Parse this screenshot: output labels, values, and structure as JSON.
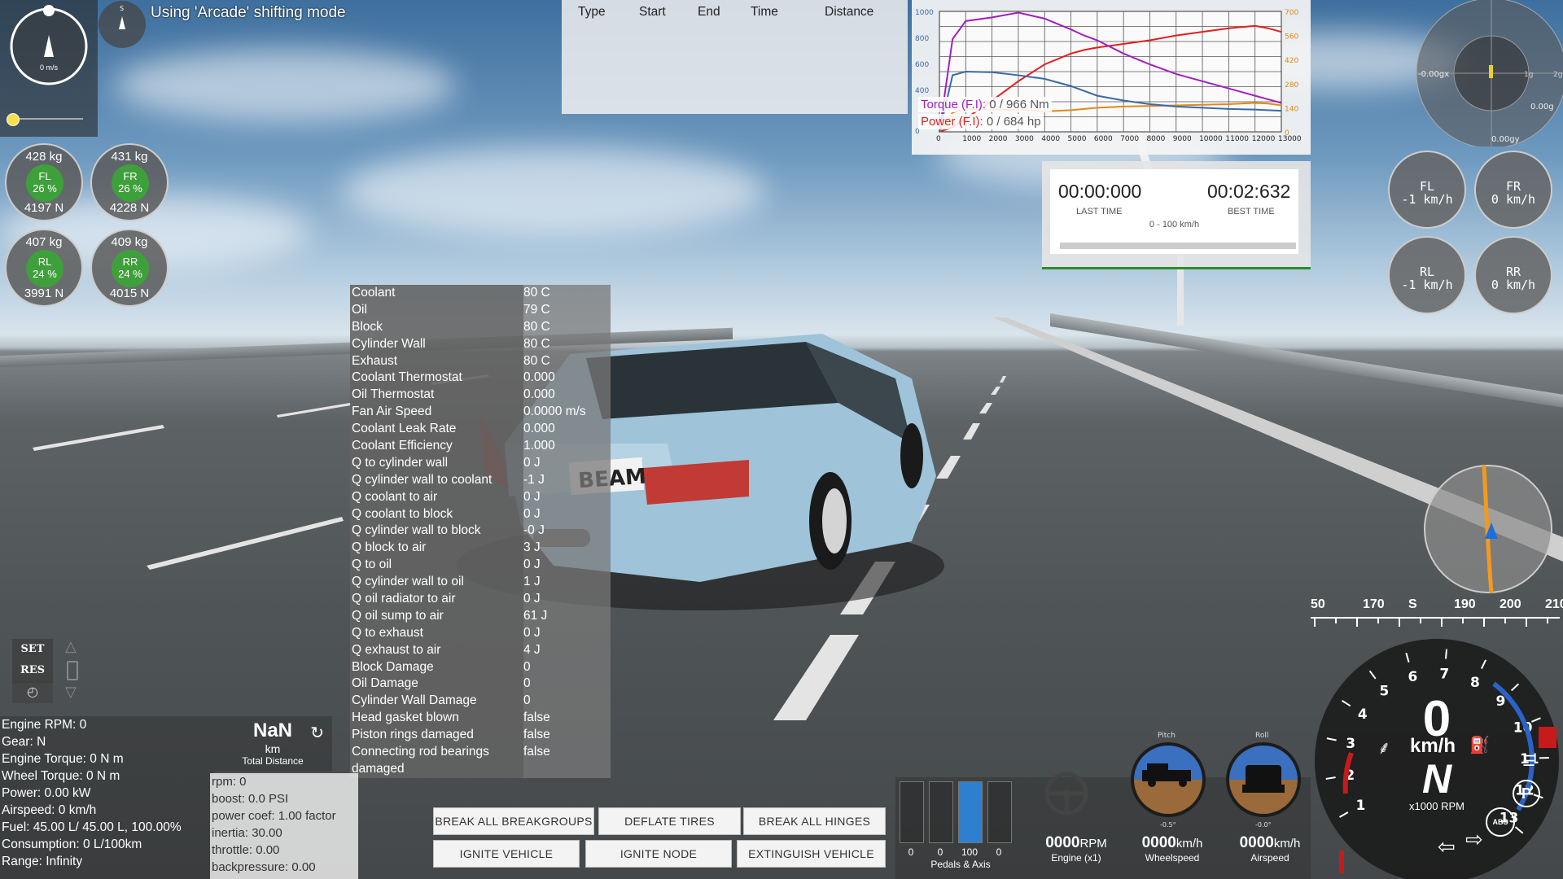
{
  "status_message": "Using 'Arcade' shifting mode",
  "compass_small": {
    "n_label": "S"
  },
  "compass_big": {
    "speed": "0 m/s"
  },
  "tires": [
    {
      "id": "FL",
      "mass": "428  kg",
      "pct": "26 %",
      "force": "4197  N"
    },
    {
      "id": "FR",
      "mass": "431  kg",
      "pct": "26 %",
      "force": "4228  N"
    },
    {
      "id": "RL",
      "mass": "407  kg",
      "pct": "24 %",
      "force": "3991  N"
    },
    {
      "id": "RR",
      "mass": "409  kg",
      "pct": "24 %",
      "force": "4015  N"
    }
  ],
  "drag_table": {
    "headers": [
      "Type",
      "Start",
      "End",
      "Time",
      "Distance"
    ]
  },
  "chart_data": {
    "type": "line",
    "left_ticks": [
      "1000",
      "800",
      "600",
      "400",
      "0"
    ],
    "right_ticks": [
      "700",
      "560",
      "420",
      "280",
      "140",
      "0"
    ],
    "x_ticks": [
      "0",
      "1000",
      "2000",
      "3000",
      "4000",
      "5000",
      "6000",
      "7000",
      "8000",
      "9000",
      "10000",
      "11000",
      "12000",
      "13000"
    ],
    "legend": [
      {
        "name": "Torque (F.I):",
        "value": "0 / 966 Nm",
        "color": "#a020c0"
      },
      {
        "name": "Power (F.I):",
        "value": "0 / 684 hp",
        "color": "#e02020"
      }
    ],
    "x": [
      0,
      500,
      1000,
      2000,
      3000,
      4000,
      5000,
      5500,
      6000,
      7000,
      8000,
      9000,
      10000,
      11000,
      12000,
      12500,
      13000
    ],
    "series": [
      {
        "color": "#e02020",
        "values": [
          0,
          40,
          110,
          260,
          420,
          560,
          650,
          680,
          700,
          730,
          760,
          800,
          830,
          860,
          880,
          860,
          830
        ]
      },
      {
        "color": "#a020c0",
        "values": [
          0,
          770,
          920,
          950,
          990,
          940,
          850,
          800,
          760,
          650,
          560,
          480,
          420,
          360,
          300,
          270,
          240
        ]
      },
      {
        "color": "#e08a1a",
        "values": [
          0,
          160,
          190,
          185,
          180,
          170,
          180,
          190,
          200,
          210,
          215,
          220,
          225,
          230,
          240,
          235,
          220
        ]
      },
      {
        "color": "#3a6aa6",
        "values": [
          0,
          470,
          500,
          495,
          470,
          440,
          380,
          340,
          300,
          260,
          230,
          210,
          200,
          190,
          185,
          180,
          175
        ]
      }
    ],
    "ylim": [
      0,
      1000
    ],
    "xlim": [
      0,
      13000
    ]
  },
  "timer": {
    "last_time": "00:00:000",
    "last_label": "LAST TIME",
    "best_time": "00:02:632",
    "best_label": "BEST TIME",
    "range": "0 - 100 km/h"
  },
  "wheel_speeds": [
    {
      "id": "FL",
      "speed": "-1 km/h"
    },
    {
      "id": "FR",
      "speed": "0 km/h"
    },
    {
      "id": "RL",
      "speed": "-1 km/h"
    },
    {
      "id": "RR",
      "speed": "0 km/h"
    }
  ],
  "gforce": {
    "x": "-0.00gx",
    "y": "0.00gy",
    "one_g": "1g",
    "two_g": "2g",
    "z": "0.00g"
  },
  "thermals": [
    {
      "k": "Coolant",
      "v": "80 C"
    },
    {
      "k": "Oil",
      "v": "79 C"
    },
    {
      "k": "Block",
      "v": "80 C"
    },
    {
      "k": "Cylinder Wall",
      "v": "80 C"
    },
    {
      "k": "Exhaust",
      "v": "80 C"
    },
    {
      "k": "Coolant Thermostat",
      "v": "0.000"
    },
    {
      "k": "Oil Thermostat",
      "v": "0.000"
    },
    {
      "k": "Fan Air Speed",
      "v": "0.0000 m/s"
    },
    {
      "k": "Coolant Leak Rate",
      "v": "0.000"
    },
    {
      "k": "Coolant Efficiency",
      "v": "1.000"
    },
    {
      "k": "Q to cylinder wall",
      "v": "0 J"
    },
    {
      "k": "Q cylinder wall to coolant",
      "v": "-1 J"
    },
    {
      "k": "Q coolant to air",
      "v": "0 J"
    },
    {
      "k": "Q coolant to block",
      "v": "0 J"
    },
    {
      "k": "Q cylinder wall to block",
      "v": "-0 J"
    },
    {
      "k": "Q block to air",
      "v": "3 J"
    },
    {
      "k": "Q to oil",
      "v": "0 J"
    },
    {
      "k": "Q cylinder wall to oil",
      "v": "1 J"
    },
    {
      "k": "Q oil radiator to air",
      "v": "0 J"
    },
    {
      "k": "Q oil sump to air",
      "v": "61 J"
    },
    {
      "k": "Q to exhaust",
      "v": "0 J"
    },
    {
      "k": "Q exhaust to air",
      "v": "4 J"
    },
    {
      "k": "Block Damage",
      "v": "0"
    },
    {
      "k": "Oil Damage",
      "v": "0"
    },
    {
      "k": "Cylinder Wall Damage",
      "v": "0"
    },
    {
      "k": "Head gasket blown",
      "v": "false"
    },
    {
      "k": "Piston rings damaged",
      "v": "false"
    },
    {
      "k": "Connecting rod bearings",
      "v": "false"
    },
    {
      "k": "damaged",
      "v": ""
    }
  ],
  "cruise": {
    "set": "SET",
    "res": "RES"
  },
  "trip": {
    "value": "NaN",
    "unit": "km",
    "label": "Total Distance"
  },
  "engine_info": [
    "Engine RPM: 0",
    "Gear: N",
    "Engine Torque: 0 N m",
    "Wheel Torque: 0 N m",
    "Power: 0.00 kW",
    "Airspeed: 0 km/h",
    "Fuel: 45.00 L/ 45.00 L, 100.00%",
    "Consumption: 0 L/100km",
    "Range: Infinity"
  ],
  "turbo_info": [
    "rpm: 0",
    "boost: 0.0 PSI",
    "power coef: 1.00 factor",
    "inertia: 30.00",
    "throttle: 0.00",
    "backpressure: 0.00"
  ],
  "buttons": {
    "break_groups": "BREAK ALL BREAKGROUPS",
    "deflate": "DEFLATE TIRES",
    "hinges": "BREAK ALL HINGES",
    "ignite_vehicle": "IGNITE VEHICLE",
    "ignite_node": "IGNITE NODE",
    "extinguish": "EXTINGUISH VEHICLE"
  },
  "pedals": {
    "values": [
      "0",
      "0",
      "100",
      "0"
    ],
    "levels": [
      0,
      0,
      1,
      0
    ],
    "label": "Pedals & Axis"
  },
  "readouts": [
    {
      "big": "0000",
      "unit": "RPM",
      "label": "Engine (x1)"
    },
    {
      "big": "0000",
      "unit": "km/h",
      "label": "Wheelspeed"
    },
    {
      "big": "0000",
      "unit": "km/h",
      "label": "Airspeed"
    }
  ],
  "attitude": {
    "pitch_label": "Pitch",
    "roll_label": "Roll",
    "pitch_val": "-0.5°",
    "roll_val": "-0.0°"
  },
  "heading_tape": [
    "50",
    "170",
    "S",
    "190",
    "200",
    "210"
  ],
  "dash": {
    "speed": "0",
    "speed_unit": "km/h",
    "gear": "N",
    "rpm_unit": "x1000 RPM",
    "rpm_ticks": [
      "1",
      "2",
      "3",
      "4",
      "5",
      "6",
      "7",
      "8",
      "9",
      "10",
      "11",
      "12",
      "13"
    ],
    "abs": "ABS",
    "park": "P"
  },
  "license_plate": "BEAM"
}
